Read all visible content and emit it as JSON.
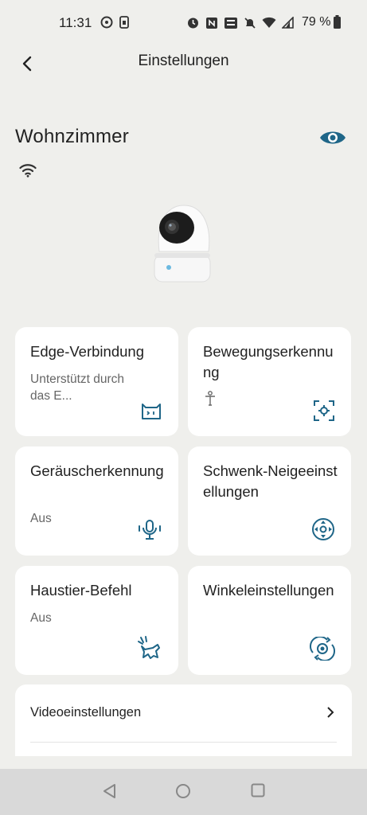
{
  "status_bar": {
    "time": "11:31",
    "battery": "79 %"
  },
  "header": {
    "title": "Einstellungen"
  },
  "device": {
    "name": "Wohnzimmer"
  },
  "cards": [
    {
      "title": "Edge-Verbindung",
      "subtitle": "Unterstützt durch das E...",
      "icon": "robot-face-icon"
    },
    {
      "title": "Bewegungserkennung",
      "subtitle": "",
      "icon": "motion-detection-icon"
    },
    {
      "title": "Geräuscherkennung",
      "subtitle": "Aus",
      "icon": "microphone-icon"
    },
    {
      "title": "Schwenk-Neigeeinstellungen",
      "subtitle": "",
      "icon": "pan-tilt-icon"
    },
    {
      "title": "Haustier-Befehl",
      "subtitle": "Aus",
      "icon": "pet-icon"
    },
    {
      "title": "Winkeleinstellungen",
      "subtitle": "",
      "icon": "angle-rotate-icon"
    }
  ],
  "list": {
    "items": [
      {
        "label": "Videoeinstellungen"
      }
    ]
  },
  "colors": {
    "accent": "#1f6688",
    "background": "#efefec",
    "card": "#ffffff"
  }
}
